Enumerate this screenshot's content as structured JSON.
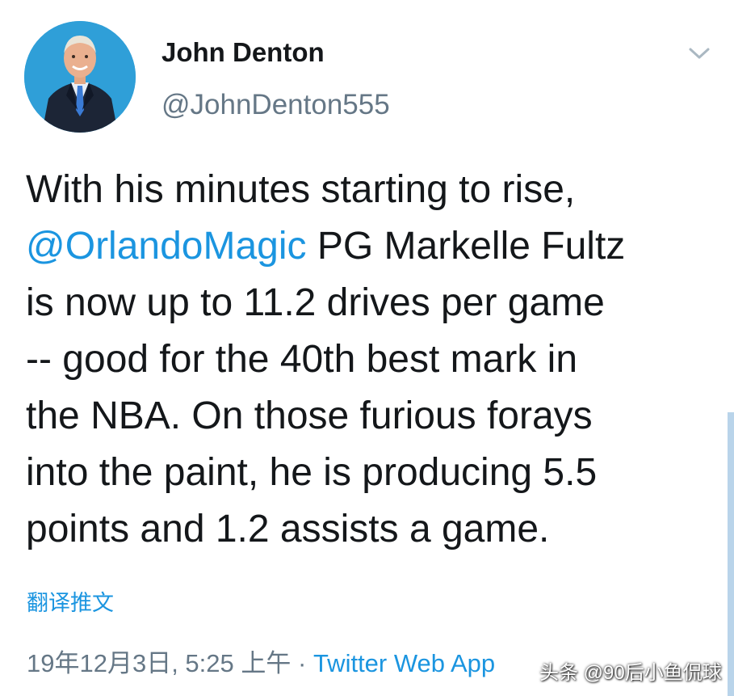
{
  "author": {
    "name": "John Denton",
    "handle": "@JohnDenton555",
    "avatar_icon": "profile-photo"
  },
  "menu_icon": "chevron-down-icon",
  "tweet": {
    "lines": [
      {
        "text": "With his minutes starting to rise,"
      },
      {
        "mention": "@OrlandoMagic",
        "text": " PG Markelle Fultz"
      },
      {
        "text": "is now up to 11.2 drives per game"
      },
      {
        "text": "-- good for the 40th best mark in"
      },
      {
        "text": "the NBA. On those furious forays"
      },
      {
        "text": "into the paint, he is producing 5.5"
      },
      {
        "text": "points and 1.2 assists a game."
      }
    ]
  },
  "translate_label": "翻译推文",
  "meta": {
    "timestamp": "19年12月3日, 5:25 上午",
    "separator": " · ",
    "source": "Twitter Web App"
  },
  "watermark": "头条 @90后小鱼侃球",
  "colors": {
    "link": "#1b95e0",
    "secondary_text": "#657786",
    "primary_text": "#14171a",
    "avatar_bg": "#2f9fd8"
  }
}
